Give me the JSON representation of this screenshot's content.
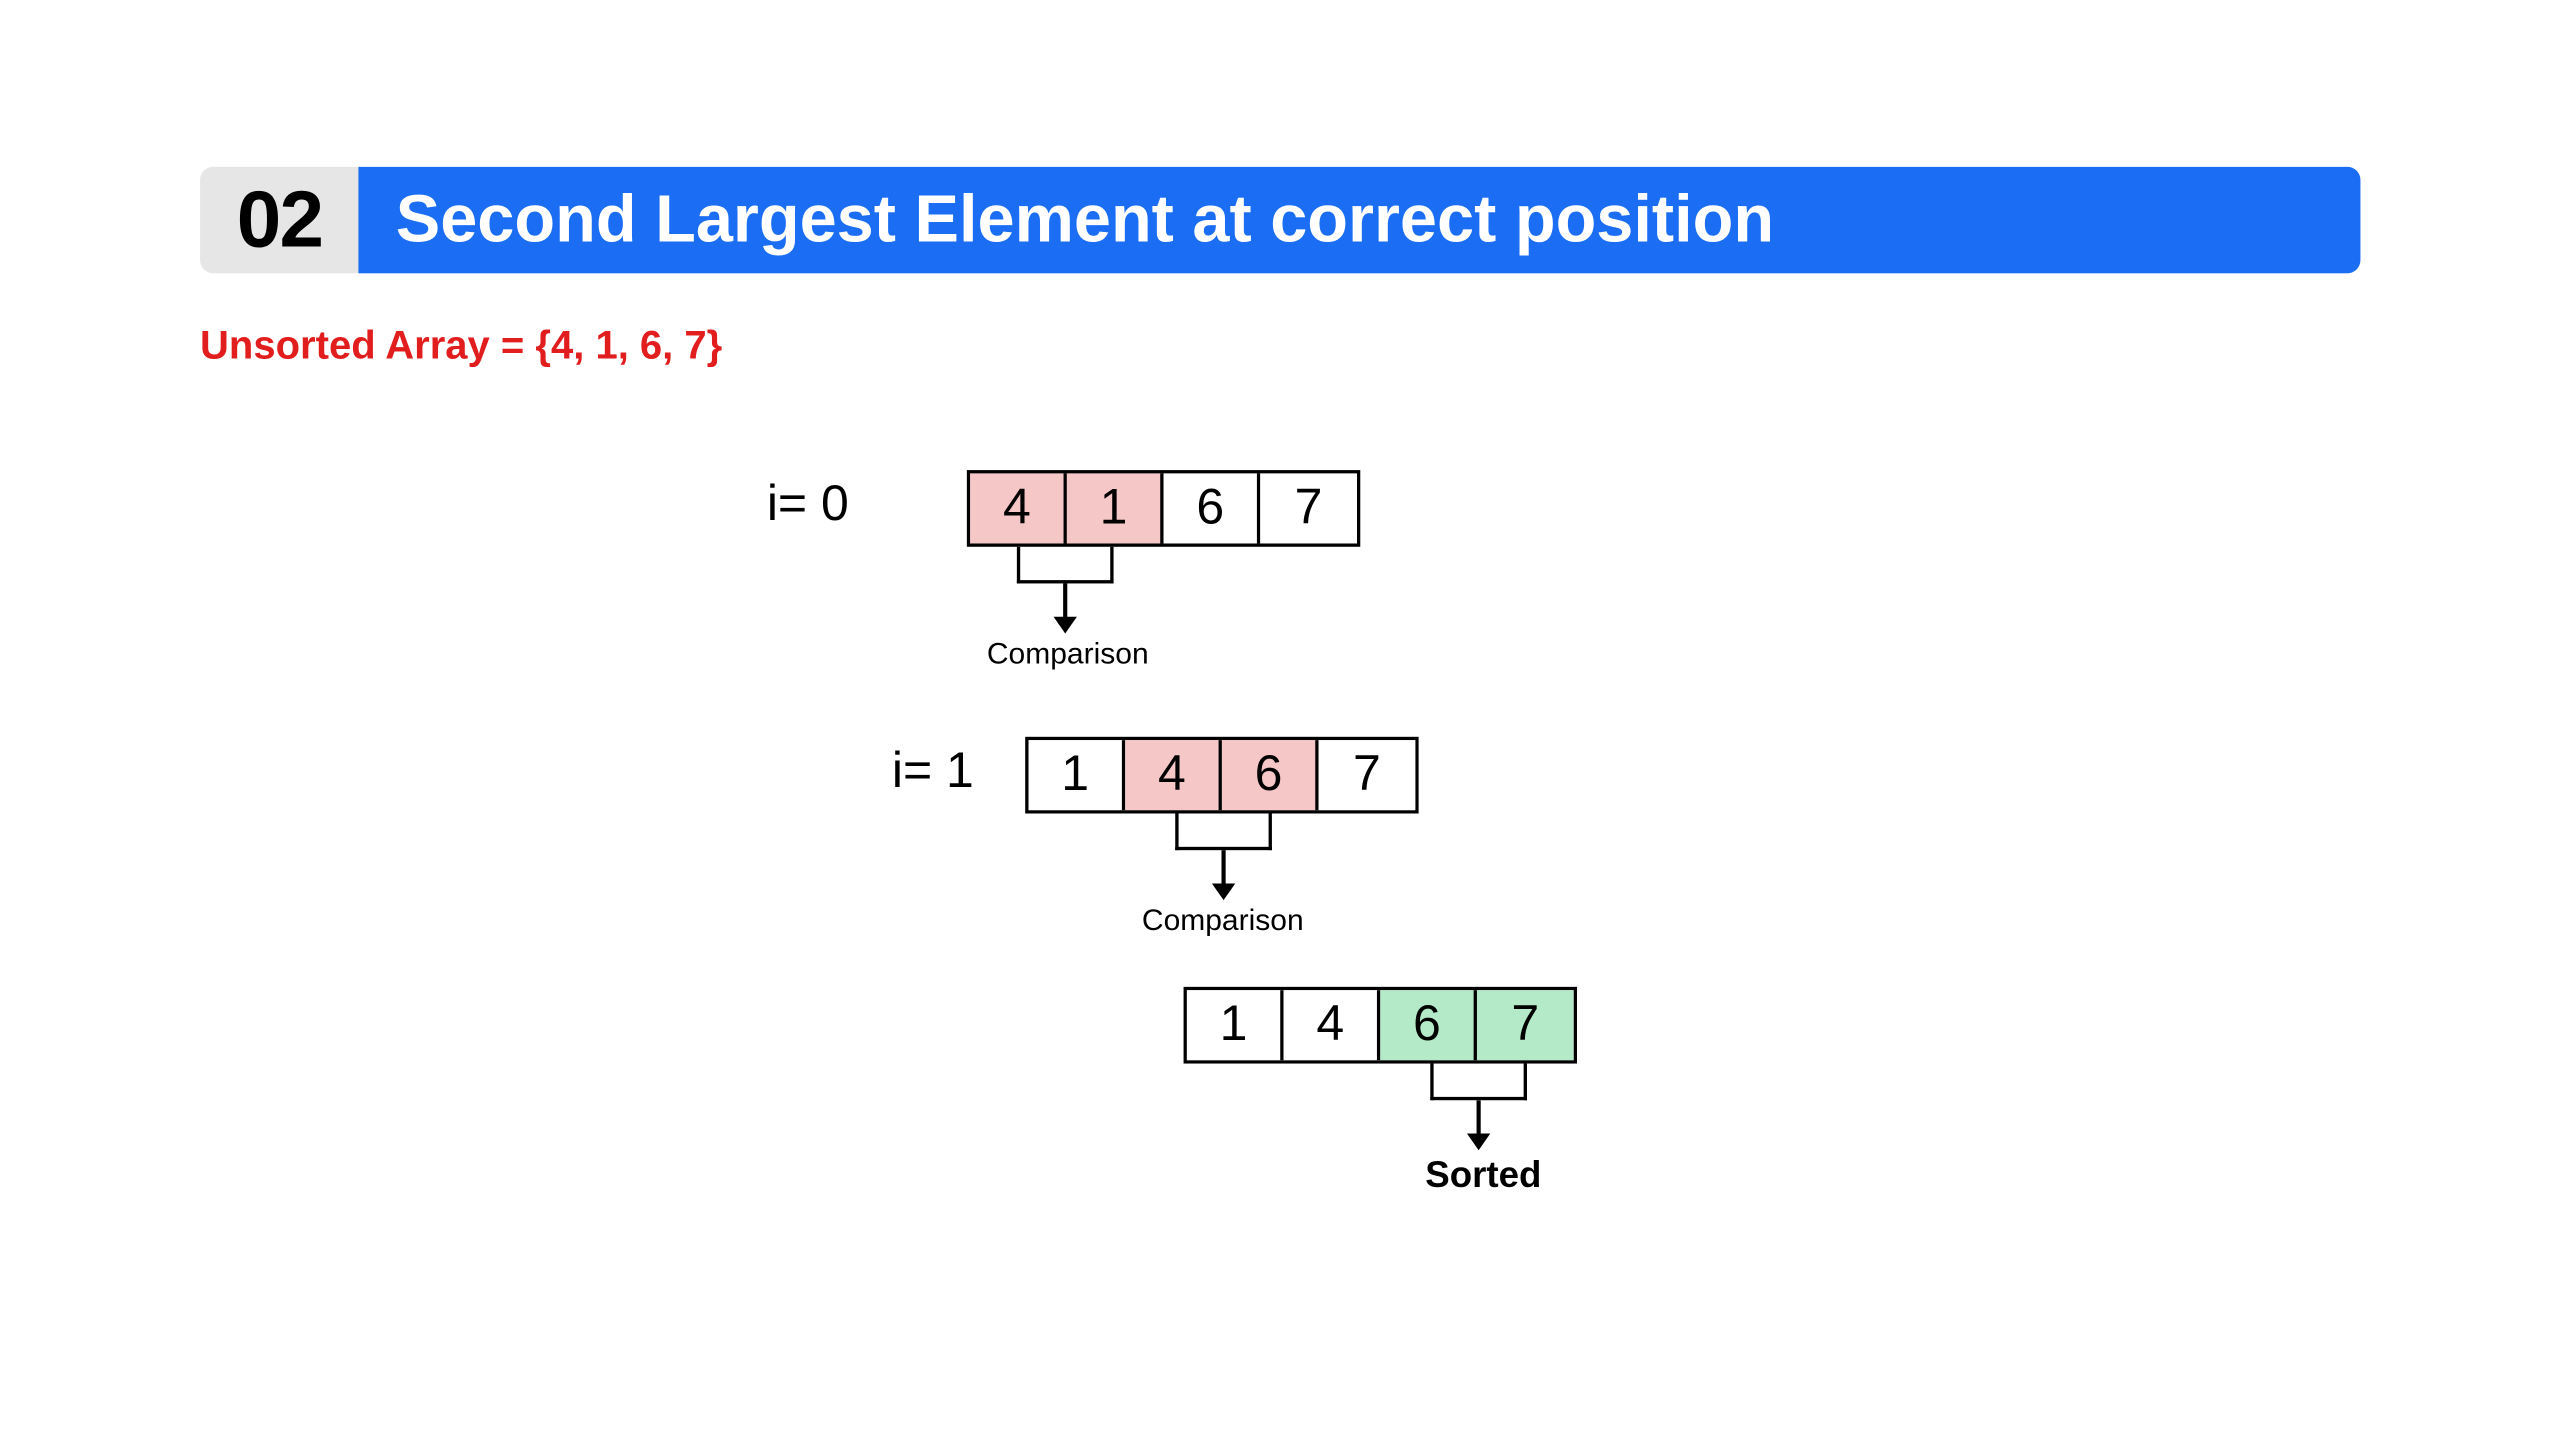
{
  "step": "02",
  "title": "Second Largest Element at correct position",
  "subtitle": "Unsorted Array = {4, 1, 6, 7}",
  "rows": [
    {
      "label": "i= 0",
      "cells": [
        "4",
        "1",
        "6",
        "7"
      ],
      "highlight": "pink",
      "highlightIdx": [
        0,
        1
      ],
      "bracketUnder": [
        0,
        1
      ],
      "caption": "Comparison"
    },
    {
      "label": "i= 1",
      "cells": [
        "1",
        "4",
        "6",
        "7"
      ],
      "highlight": "pink",
      "highlightIdx": [
        1,
        2
      ],
      "bracketUnder": [
        1,
        2
      ],
      "caption": "Comparison"
    },
    {
      "label": "",
      "cells": [
        "1",
        "4",
        "6",
        "7"
      ],
      "highlight": "green",
      "highlightIdx": [
        2,
        3
      ],
      "bracketUnder": [
        2,
        3
      ],
      "caption": "Sorted"
    }
  ],
  "captions": {
    "comparison": "Comparison",
    "sorted": "Sorted"
  }
}
